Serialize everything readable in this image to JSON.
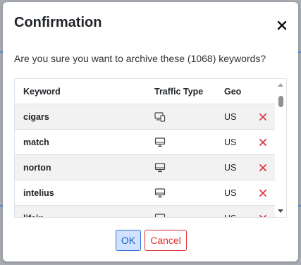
{
  "dialog": {
    "title": "Confirmation",
    "message": "Are you sure you want to archive these (1068) keywords?",
    "close_icon": "close-icon"
  },
  "table": {
    "headers": {
      "keyword": "Keyword",
      "traffic_type": "Traffic Type",
      "geo": "Geo"
    },
    "rows": [
      {
        "keyword": "cigars",
        "traffic_icon": "mobile-desktop-icon",
        "geo": "US",
        "action_icon": "remove-icon"
      },
      {
        "keyword": "match",
        "traffic_icon": "desktop-icon",
        "geo": "US",
        "action_icon": "remove-icon"
      },
      {
        "keyword": "norton",
        "traffic_icon": "desktop-icon",
        "geo": "US",
        "action_icon": "remove-icon"
      },
      {
        "keyword": "intelius",
        "traffic_icon": "desktop-icon",
        "geo": "US",
        "action_icon": "remove-icon"
      },
      {
        "keyword": "lifein",
        "traffic_icon": "desktop-icon",
        "geo": "US",
        "action_icon": "remove-icon"
      }
    ]
  },
  "buttons": {
    "ok": "OK",
    "cancel": "Cancel"
  },
  "colors": {
    "remove": "#dc3545",
    "primary": "#2f6fd6",
    "danger": "#dd3333"
  }
}
